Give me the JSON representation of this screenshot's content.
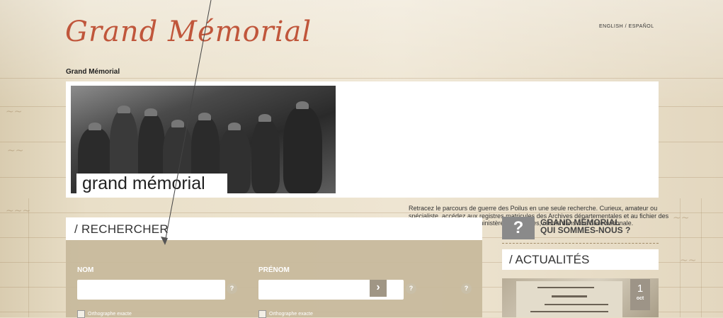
{
  "logo": {
    "text": "Grand Mémorial"
  },
  "languages": {
    "english": "ENGLISH",
    "separator": " / ",
    "espanol": "ESPAÑOL"
  },
  "breadcrumb": {
    "label": "Grand Mémorial"
  },
  "hero": {
    "photo_caption": "grand mémorial",
    "intro": "Retracez le parcours de guerre des Poilus en une seule recherche. Curieux, amateur ou spécialiste, accédez aux registres matricules des Archives départementales et au fichier des Morts pour la France du ministère des Armées, réunis dans une base nationale."
  },
  "search": {
    "title": "/  RECHERCHER",
    "nom_label": "NOM",
    "prenom_label": "PRÉNOM",
    "nom_value": "",
    "prenom_value": "",
    "help": "?",
    "submit": "›",
    "exact_label": "Orthographe exacte"
  },
  "sidebar": {
    "about_icon": "?",
    "about_line1": "GRAND MÉMORIAL",
    "about_line2": "QUI SOMMES-NOUS ?",
    "news_title": "/  ACTUALITÉS",
    "news_day": "1",
    "news_month": "oct"
  },
  "colors": {
    "brand": "#c0563b",
    "panel": "#c7b99b",
    "button": "#a09685"
  }
}
